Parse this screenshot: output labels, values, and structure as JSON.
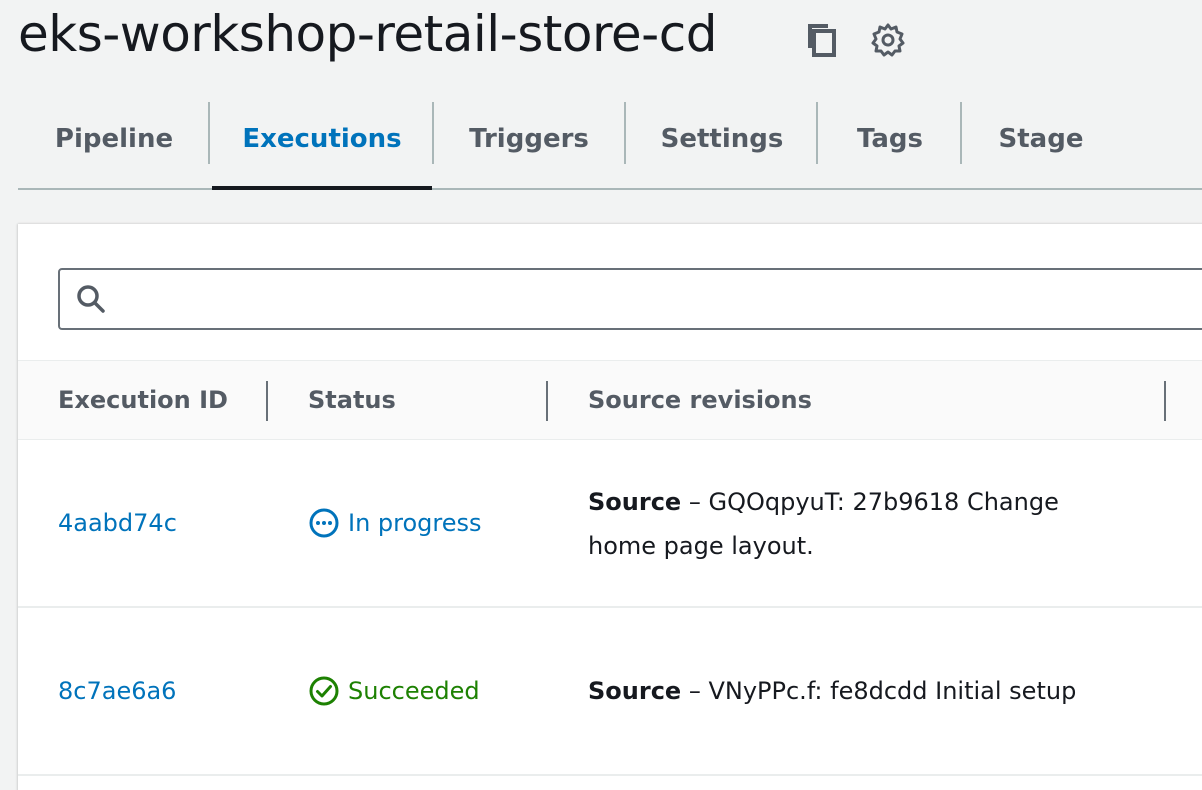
{
  "header": {
    "title": "eks-workshop-retail-store-cd",
    "icons": [
      "copy-icon",
      "settings-gear-icon"
    ]
  },
  "tabs": [
    {
      "label": "Pipeline",
      "active": false
    },
    {
      "label": "Executions",
      "active": true
    },
    {
      "label": "Triggers",
      "active": false
    },
    {
      "label": "Settings",
      "active": false
    },
    {
      "label": "Tags",
      "active": false
    },
    {
      "label": "Stage",
      "active": false
    }
  ],
  "search": {
    "value": "",
    "placeholder": ""
  },
  "table": {
    "columns": [
      "Execution ID",
      "Status",
      "Source revisions"
    ],
    "rows": [
      {
        "execution_id": "4aabd74c",
        "status": "In progress",
        "status_icon": "in-progress-icon",
        "source_name": "Source",
        "source_sep": " – ",
        "source_text": "GQOqpyuT: 27b9618 Change home page layout."
      },
      {
        "execution_id": "8c7ae6a6",
        "status": "Succeeded",
        "status_icon": "success-check-icon",
        "source_name": "Source",
        "source_sep": " – ",
        "source_text": "VNyPPc.f: fe8dcdd Initial setup"
      }
    ]
  },
  "colors": {
    "link": "#0073bb",
    "in_progress": "#0073bb",
    "success": "#1d8102",
    "background": "#f2f3f3"
  }
}
